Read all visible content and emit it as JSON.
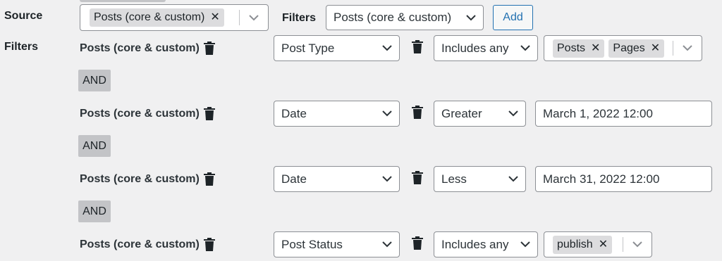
{
  "source": {
    "label": "Source",
    "chip": "Posts (core & custom)",
    "chip_remove": "✕"
  },
  "top_filters": {
    "label": "Filters",
    "select_value": "Posts (core & custom)",
    "add_button": "Add"
  },
  "filters_label": "Filters",
  "connector": "AND",
  "filters": [
    {
      "name": "Posts (core & custom)",
      "field": "Post Type",
      "operator": "Includes any",
      "values": [
        "Posts",
        "Pages"
      ]
    },
    {
      "name": "Posts (core & custom)",
      "field": "Date",
      "operator": "Greater",
      "value": "March 1, 2022 12:00"
    },
    {
      "name": "Posts (core & custom)",
      "field": "Date",
      "operator": "Less",
      "value": "March 31, 2022 12:00"
    },
    {
      "name": "Posts (core & custom)",
      "field": "Post Status",
      "operator": "Includes any",
      "values": [
        "publish"
      ]
    }
  ],
  "icons": {
    "trash": "trash-icon",
    "chevron": "chevron-down-icon",
    "remove": "close-icon"
  },
  "colors": {
    "background": "#f0f0f1",
    "accent": "#2271b1",
    "chip": "#dcdcde",
    "and_badge": "#c3c4c7"
  }
}
